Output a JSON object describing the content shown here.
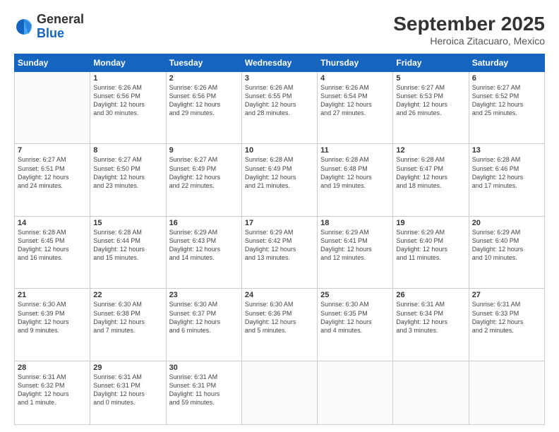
{
  "header": {
    "logo_general": "General",
    "logo_blue": "Blue",
    "title": "September 2025",
    "subtitle": "Heroica Zitacuaro, Mexico"
  },
  "weekdays": [
    "Sunday",
    "Monday",
    "Tuesday",
    "Wednesday",
    "Thursday",
    "Friday",
    "Saturday"
  ],
  "weeks": [
    [
      {
        "day": "",
        "info": ""
      },
      {
        "day": "1",
        "info": "Sunrise: 6:26 AM\nSunset: 6:56 PM\nDaylight: 12 hours\nand 30 minutes."
      },
      {
        "day": "2",
        "info": "Sunrise: 6:26 AM\nSunset: 6:56 PM\nDaylight: 12 hours\nand 29 minutes."
      },
      {
        "day": "3",
        "info": "Sunrise: 6:26 AM\nSunset: 6:55 PM\nDaylight: 12 hours\nand 28 minutes."
      },
      {
        "day": "4",
        "info": "Sunrise: 6:26 AM\nSunset: 6:54 PM\nDaylight: 12 hours\nand 27 minutes."
      },
      {
        "day": "5",
        "info": "Sunrise: 6:27 AM\nSunset: 6:53 PM\nDaylight: 12 hours\nand 26 minutes."
      },
      {
        "day": "6",
        "info": "Sunrise: 6:27 AM\nSunset: 6:52 PM\nDaylight: 12 hours\nand 25 minutes."
      }
    ],
    [
      {
        "day": "7",
        "info": "Sunrise: 6:27 AM\nSunset: 6:51 PM\nDaylight: 12 hours\nand 24 minutes."
      },
      {
        "day": "8",
        "info": "Sunrise: 6:27 AM\nSunset: 6:50 PM\nDaylight: 12 hours\nand 23 minutes."
      },
      {
        "day": "9",
        "info": "Sunrise: 6:27 AM\nSunset: 6:49 PM\nDaylight: 12 hours\nand 22 minutes."
      },
      {
        "day": "10",
        "info": "Sunrise: 6:28 AM\nSunset: 6:49 PM\nDaylight: 12 hours\nand 21 minutes."
      },
      {
        "day": "11",
        "info": "Sunrise: 6:28 AM\nSunset: 6:48 PM\nDaylight: 12 hours\nand 19 minutes."
      },
      {
        "day": "12",
        "info": "Sunrise: 6:28 AM\nSunset: 6:47 PM\nDaylight: 12 hours\nand 18 minutes."
      },
      {
        "day": "13",
        "info": "Sunrise: 6:28 AM\nSunset: 6:46 PM\nDaylight: 12 hours\nand 17 minutes."
      }
    ],
    [
      {
        "day": "14",
        "info": "Sunrise: 6:28 AM\nSunset: 6:45 PM\nDaylight: 12 hours\nand 16 minutes."
      },
      {
        "day": "15",
        "info": "Sunrise: 6:28 AM\nSunset: 6:44 PM\nDaylight: 12 hours\nand 15 minutes."
      },
      {
        "day": "16",
        "info": "Sunrise: 6:29 AM\nSunset: 6:43 PM\nDaylight: 12 hours\nand 14 minutes."
      },
      {
        "day": "17",
        "info": "Sunrise: 6:29 AM\nSunset: 6:42 PM\nDaylight: 12 hours\nand 13 minutes."
      },
      {
        "day": "18",
        "info": "Sunrise: 6:29 AM\nSunset: 6:41 PM\nDaylight: 12 hours\nand 12 minutes."
      },
      {
        "day": "19",
        "info": "Sunrise: 6:29 AM\nSunset: 6:40 PM\nDaylight: 12 hours\nand 11 minutes."
      },
      {
        "day": "20",
        "info": "Sunrise: 6:29 AM\nSunset: 6:40 PM\nDaylight: 12 hours\nand 10 minutes."
      }
    ],
    [
      {
        "day": "21",
        "info": "Sunrise: 6:30 AM\nSunset: 6:39 PM\nDaylight: 12 hours\nand 9 minutes."
      },
      {
        "day": "22",
        "info": "Sunrise: 6:30 AM\nSunset: 6:38 PM\nDaylight: 12 hours\nand 7 minutes."
      },
      {
        "day": "23",
        "info": "Sunrise: 6:30 AM\nSunset: 6:37 PM\nDaylight: 12 hours\nand 6 minutes."
      },
      {
        "day": "24",
        "info": "Sunrise: 6:30 AM\nSunset: 6:36 PM\nDaylight: 12 hours\nand 5 minutes."
      },
      {
        "day": "25",
        "info": "Sunrise: 6:30 AM\nSunset: 6:35 PM\nDaylight: 12 hours\nand 4 minutes."
      },
      {
        "day": "26",
        "info": "Sunrise: 6:31 AM\nSunset: 6:34 PM\nDaylight: 12 hours\nand 3 minutes."
      },
      {
        "day": "27",
        "info": "Sunrise: 6:31 AM\nSunset: 6:33 PM\nDaylight: 12 hours\nand 2 minutes."
      }
    ],
    [
      {
        "day": "28",
        "info": "Sunrise: 6:31 AM\nSunset: 6:32 PM\nDaylight: 12 hours\nand 1 minute."
      },
      {
        "day": "29",
        "info": "Sunrise: 6:31 AM\nSunset: 6:31 PM\nDaylight: 12 hours\nand 0 minutes."
      },
      {
        "day": "30",
        "info": "Sunrise: 6:31 AM\nSunset: 6:31 PM\nDaylight: 11 hours\nand 59 minutes."
      },
      {
        "day": "",
        "info": ""
      },
      {
        "day": "",
        "info": ""
      },
      {
        "day": "",
        "info": ""
      },
      {
        "day": "",
        "info": ""
      }
    ]
  ]
}
